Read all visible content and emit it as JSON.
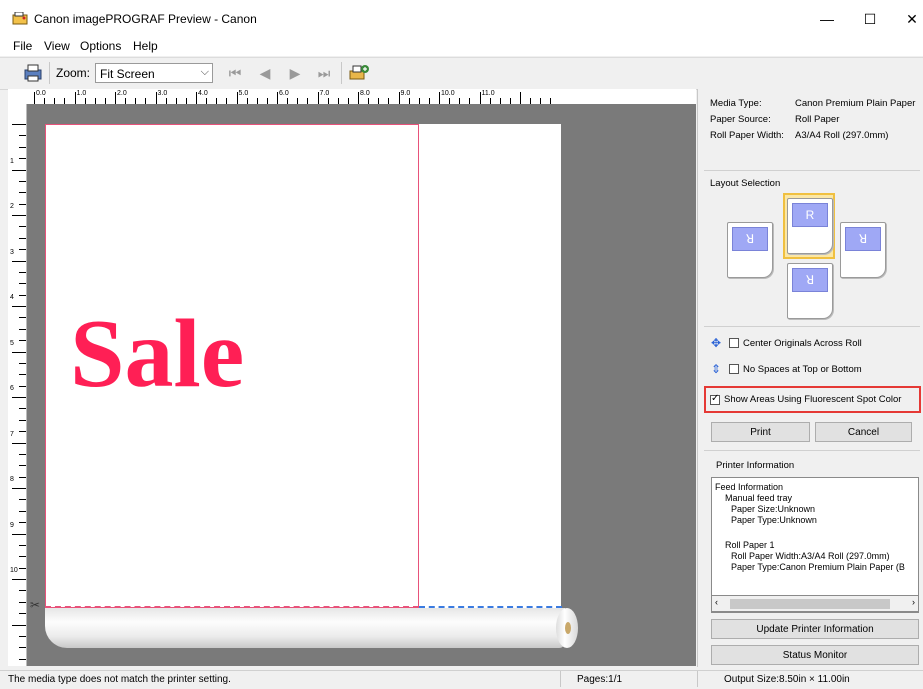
{
  "window": {
    "title": "Canon imagePROGRAF Preview - Canon",
    "minimize": "—",
    "maximize": "☐",
    "close": "✕"
  },
  "menu": [
    "File",
    "View",
    "Options",
    "Help"
  ],
  "toolbar": {
    "zoom_label": "Zoom:",
    "zoom_value": "Fit Screen",
    "nav_icons": [
      "first-page-icon",
      "prev-page-icon",
      "next-page-icon",
      "last-page-icon"
    ]
  },
  "ruler_h": [
    "0.0",
    "1.0",
    "2.0",
    "3.0",
    "4.0",
    "5.0",
    "6.0",
    "7.0",
    "8.0",
    "9.0",
    "10.0",
    "11.0"
  ],
  "ruler_v": [
    "1",
    "2",
    "3",
    "4",
    "5",
    "6",
    "7",
    "8",
    "9",
    "10"
  ],
  "preview": {
    "text": "Sale",
    "text_color": "#ff1f55",
    "outline_color": "#e8527a",
    "roll_cut_color": "#3a7be0"
  },
  "media_info": {
    "media_type_label": "Media Type:",
    "media_type": "Canon Premium Plain Paper",
    "paper_source_label": "Paper Source:",
    "paper_source": "Roll Paper",
    "roll_width_label": "Roll Paper Width:",
    "roll_width": "A3/A4 Roll (297.0mm)"
  },
  "layout": {
    "label": "Layout Selection",
    "glyphs": [
      "ꓤ",
      "R",
      "ꓤ",
      "ꓤ"
    ]
  },
  "options": {
    "center_originals": "Center Originals Across Roll",
    "no_spaces": "No Spaces at Top or Bottom",
    "fluorescent": "Show Areas Using Fluorescent Spot Color"
  },
  "buttons": {
    "print": "Print",
    "cancel": "Cancel",
    "update_printer": "Update Printer Information",
    "status_monitor": "Status Monitor"
  },
  "printer_info": {
    "label": "Printer Information",
    "lines": [
      "Feed Information",
      "Manual feed tray",
      "Paper Size:Unknown",
      "Paper Type:Unknown",
      "",
      "Roll Paper 1",
      "Roll Paper Width:A3/A4 Roll (297.0mm)",
      "Paper Type:Canon Premium Plain Paper (B"
    ]
  },
  "status": {
    "message": "The media type does not match the printer setting.",
    "pages": "Pages:1/1",
    "output_size": "Output Size:8.50in × 11.00in"
  },
  "colors": {
    "highlight": "#e53935",
    "layout_selected": "#f0c040"
  }
}
